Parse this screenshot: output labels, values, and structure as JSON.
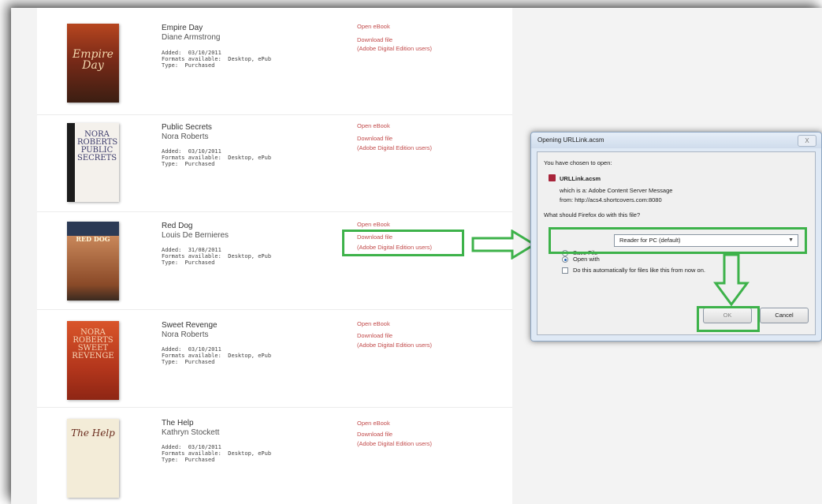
{
  "books": [
    {
      "title": "Empire Day",
      "author": "Diane Armstrong",
      "added": "Added:  03/10/2011",
      "formats": "Formats available:  Desktop, ePub",
      "type": "Type:  Purchased",
      "cover_text": "Empire Day",
      "links": {
        "open": "Open eBook",
        "download": "Download file",
        "adobe": "(Adobe Digital Edition users)"
      }
    },
    {
      "title": "Public Secrets",
      "author": "Nora Roberts",
      "added": "Added:  03/10/2011",
      "formats": "Formats available:  Desktop, ePub",
      "type": "Type:  Purchased",
      "cover_text": "NORA ROBERTS PUBLIC SECRETS",
      "links": {
        "open": "Open eBook",
        "download": "Download file",
        "adobe": "(Adobe Digital Edition users)"
      }
    },
    {
      "title": "Red Dog",
      "author": "Louis De Bernieres",
      "added": "Added:  31/08/2011",
      "formats": "Formats available:  Desktop, ePub",
      "type": "Type:  Purchased",
      "cover_text": "RED DOG",
      "links": {
        "open": "Open eBook",
        "download": "Download file",
        "adobe": "(Adobe Digital Edition users)"
      }
    },
    {
      "title": "Sweet Revenge",
      "author": "Nora Roberts",
      "added": "Added:  03/10/2011",
      "formats": "Formats available:  Desktop, ePub",
      "type": "Type:  Purchased",
      "cover_text": "NORA ROBERTS SWEET REVENGE",
      "links": {
        "open": "Open eBook",
        "download": "Download file",
        "adobe": "(Adobe Digital Edition users)"
      }
    },
    {
      "title": "The Help",
      "author": "Kathryn Stockett",
      "added": "Added:  03/10/2011",
      "formats": "Formats available:  Desktop, ePub",
      "type": "Type:  Purchased",
      "cover_text": "The Help",
      "links": {
        "open": "Open eBook",
        "download": "Download file",
        "adobe": "(Adobe Digital Edition users)"
      }
    }
  ],
  "dialog": {
    "title": "Opening URLLink.acsm",
    "close": "X",
    "intro": "You have chosen to open:",
    "filename": "URLLink.acsm",
    "which_is": "which is a:  Adobe Content Server Message",
    "from": "from:  http://acs4.shortcovers.com:8080",
    "question": "What should Firefox do with this file?",
    "open_with_label": "Open with",
    "open_with_value": "Reader for PC (default)",
    "open_with_selected": true,
    "save_file_label": "Save File",
    "auto_label": "Do this automatically for files like this from now on.",
    "auto_checked": false,
    "ok_label": "OK",
    "cancel_label": "Cancel"
  },
  "colors": {
    "annotation": "#3db24a",
    "link": "#c24b4b",
    "dialog_bg": "#dfe9f5"
  }
}
